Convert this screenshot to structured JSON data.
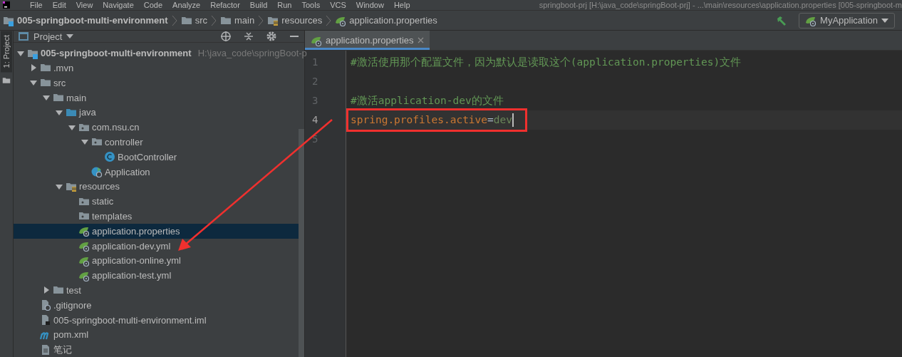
{
  "menu": [
    "File",
    "Edit",
    "View",
    "Navigate",
    "Code",
    "Analyze",
    "Refactor",
    "Build",
    "Run",
    "Tools",
    "VCS",
    "Window",
    "Help"
  ],
  "window_title": "springboot-prj [H:\\java_code\\springBoot-prj] - ...\\main\\resources\\application.properties [005-springboot-m",
  "breadcrumb": [
    {
      "label": "005-springboot-multi-environment",
      "kind": "module"
    },
    {
      "label": "src",
      "kind": "folder"
    },
    {
      "label": "main",
      "kind": "folder"
    },
    {
      "label": "resources",
      "kind": "resource-folder"
    },
    {
      "label": "application.properties",
      "kind": "spring-file"
    }
  ],
  "run_config": "MyApplication",
  "side_tab": "1: Project",
  "project_panel": {
    "title": "Project",
    "tree": [
      {
        "label": "005-springboot-multi-environment",
        "kind": "module",
        "path": "H:\\java_code\\springBoot-p",
        "expanded": true,
        "selected": false,
        "children": [
          {
            "label": ".mvn",
            "kind": "folder",
            "expanded": false,
            "selected": false
          },
          {
            "label": "src",
            "kind": "folder",
            "expanded": true,
            "selected": false,
            "children": [
              {
                "label": "main",
                "kind": "folder",
                "expanded": true,
                "selected": false,
                "children": [
                  {
                    "label": "java",
                    "kind": "source-folder",
                    "expanded": true,
                    "selected": false,
                    "children": [
                      {
                        "label": "com.nsu.cn",
                        "kind": "package",
                        "expanded": true,
                        "selected": false,
                        "children": [
                          {
                            "label": "controller",
                            "kind": "package",
                            "expanded": true,
                            "selected": false,
                            "children": [
                              {
                                "label": "BootController",
                                "kind": "class",
                                "selected": false
                              }
                            ]
                          },
                          {
                            "label": "Application",
                            "kind": "app-class",
                            "selected": false
                          }
                        ]
                      }
                    ]
                  },
                  {
                    "label": "resources",
                    "kind": "resource-folder",
                    "expanded": true,
                    "selected": false,
                    "children": [
                      {
                        "label": "static",
                        "kind": "package",
                        "selected": false
                      },
                      {
                        "label": "templates",
                        "kind": "package",
                        "selected": false
                      },
                      {
                        "label": "application.properties",
                        "kind": "spring-file",
                        "selected": true
                      },
                      {
                        "label": "application-dev.yml",
                        "kind": "spring-file",
                        "selected": false
                      },
                      {
                        "label": "application-online.yml",
                        "kind": "spring-file",
                        "selected": false
                      },
                      {
                        "label": "application-test.yml",
                        "kind": "spring-file",
                        "selected": false
                      }
                    ]
                  }
                ]
              },
              {
                "label": "test",
                "kind": "folder",
                "expanded": false,
                "selected": false
              }
            ]
          },
          {
            "label": ".gitignore",
            "kind": "ignore-file",
            "selected": false
          },
          {
            "label": "005-springboot-multi-environment.iml",
            "kind": "iml-file",
            "selected": false
          },
          {
            "label": "pom.xml",
            "kind": "maven",
            "selected": false
          },
          {
            "label": "笔记",
            "kind": "note",
            "selected": false
          }
        ]
      }
    ]
  },
  "editor": {
    "tabs": [
      {
        "label": "application.properties",
        "selected": true
      }
    ],
    "lines": [
      {
        "number": "1",
        "current": false,
        "tokens": [
          {
            "text": "#激活使用那个配置文件，因为默认是读取这个(application.properties)文件",
            "kind": "comment"
          }
        ]
      },
      {
        "number": "2",
        "current": false
      },
      {
        "number": "3",
        "current": false,
        "tokens": [
          {
            "text": "#激活application-dev的文件",
            "kind": "comment"
          }
        ]
      },
      {
        "number": "4",
        "current": true,
        "tokens": [
          {
            "text": "spring.profiles.active",
            "kind": "key"
          },
          {
            "text": "=",
            "kind": "sep"
          },
          {
            "text": "dev",
            "kind": "value"
          }
        ]
      },
      {
        "number": "5",
        "current": false
      }
    ]
  }
}
